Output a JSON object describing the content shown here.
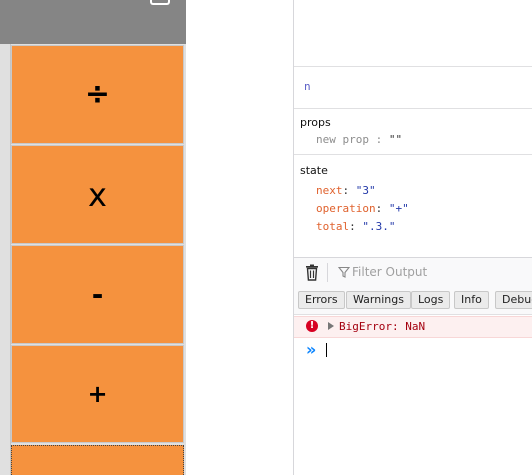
{
  "calculator": {
    "keys": {
      "divide": "÷",
      "multiply": "x",
      "subtract": "-",
      "add": "+"
    },
    "colors": {
      "key_bg": "#f5923e",
      "display_bg": "#858585"
    }
  },
  "devtools": {
    "component_name": "n",
    "props": {
      "title": "props",
      "row_key": "new prop",
      "row_sep": " : ",
      "row_value": "\"\""
    },
    "state": {
      "title": "state",
      "rows": [
        {
          "key": "next",
          "value": "\"3\""
        },
        {
          "key": "operation",
          "value": "\"+\""
        },
        {
          "key": "total",
          "value": "\".3.\""
        }
      ]
    },
    "console": {
      "filter_placeholder": "Filter Output",
      "filter_buttons": [
        "Errors",
        "Warnings",
        "Logs",
        "Info",
        "Debug"
      ],
      "error_message": "BigError: NaN",
      "prompt_symbol": "»"
    }
  }
}
